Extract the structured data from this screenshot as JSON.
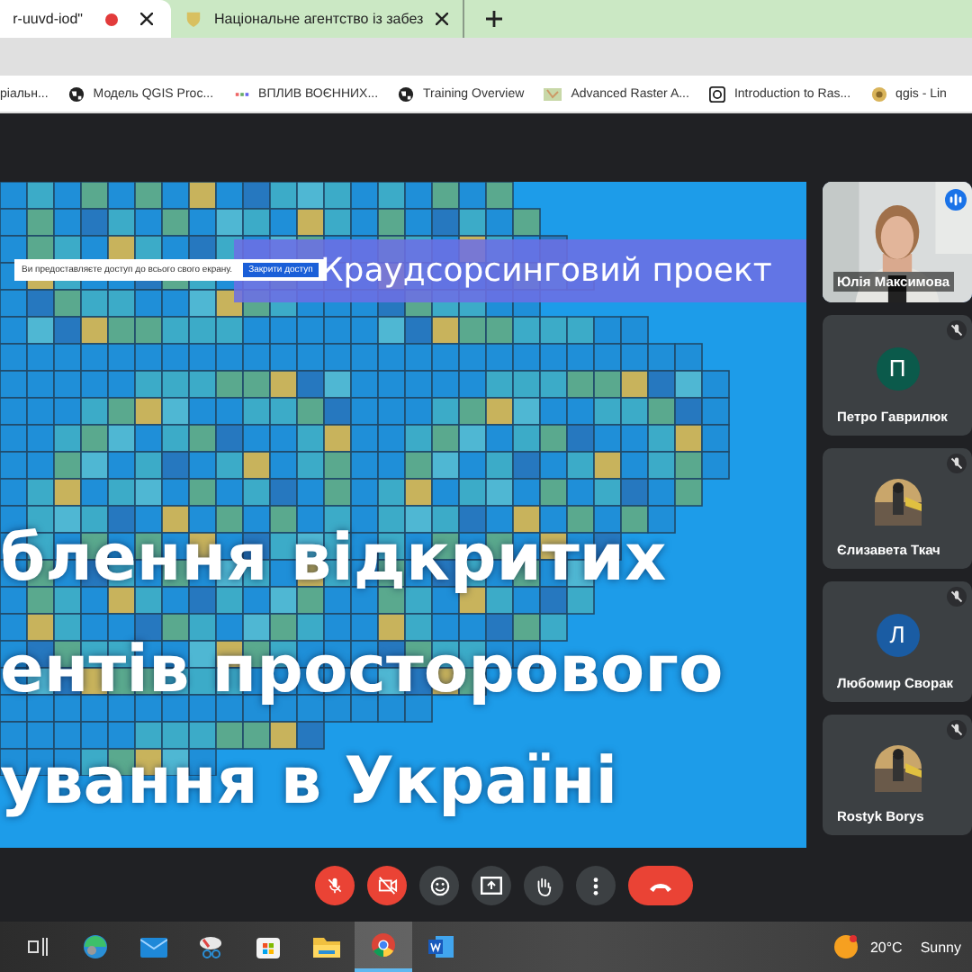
{
  "browser": {
    "tabs": [
      {
        "title": "r-uuvd-iod\"",
        "selected": true,
        "recording": true
      },
      {
        "title": "Національне агентство із забез",
        "selected": false,
        "recording": false
      }
    ],
    "bookmarks": [
      {
        "kind": "none",
        "title": "ріальн..."
      },
      {
        "kind": "globe",
        "title": "Модель QGIS Proc..."
      },
      {
        "kind": "dots",
        "title": "ВПЛИВ ВОЄННИХ..."
      },
      {
        "kind": "globe",
        "title": "Training Overview"
      },
      {
        "kind": "map",
        "title": "Advanced Raster A..."
      },
      {
        "kind": "doc",
        "title": "Introduction to Ras..."
      },
      {
        "kind": "qgis",
        "title": "qgis - Lin"
      }
    ]
  },
  "slide": {
    "banner": "Краудсорсинговий проект",
    "lines": [
      "блення відкритих",
      "ентів просторового",
      "ування в Україні"
    ],
    "share_notice": {
      "text": "Ви предоставляєте доступ до всього свого екрану.",
      "button": "Закрити доступ"
    }
  },
  "participants": [
    {
      "kind": "video",
      "name": "Юлія Максимова",
      "speaking": true,
      "muted": false
    },
    {
      "kind": "initial",
      "name": "Петро Гаврилюк",
      "initial": "П",
      "color": "#0b5a4b",
      "speaking": false,
      "muted": true
    },
    {
      "name": "Єлизавета Ткач",
      "speaking": false,
      "muted": true
    },
    {
      "kind": "initial",
      "name": "Любомир Сворак",
      "initial": "Л",
      "color": "#1a5ca3",
      "speaking": false,
      "muted": true
    },
    {
      "name": "Rostyk Borys",
      "speaking": false,
      "muted": true
    }
  ],
  "controls": [
    {
      "kind": "mic",
      "off": true
    },
    {
      "kind": "camera",
      "off": true
    },
    {
      "kind": "emoji",
      "off": false
    },
    {
      "kind": "present",
      "off": false
    },
    {
      "kind": "hand",
      "off": false
    },
    {
      "kind": "more",
      "off": false
    },
    {
      "kind": "leave",
      "off": true
    }
  ],
  "taskbar": {
    "apps": [
      {
        "kind": "taskview",
        "active": false
      },
      {
        "kind": "edge",
        "active": false
      },
      {
        "kind": "mail",
        "active": false
      },
      {
        "kind": "snip",
        "active": false
      },
      {
        "kind": "store",
        "active": false
      },
      {
        "kind": "folder",
        "active": false
      },
      {
        "kind": "chrome",
        "active": true
      },
      {
        "kind": "word",
        "active": false
      }
    ],
    "weather": {
      "temp": "20°C",
      "condition": "Sunny"
    }
  }
}
